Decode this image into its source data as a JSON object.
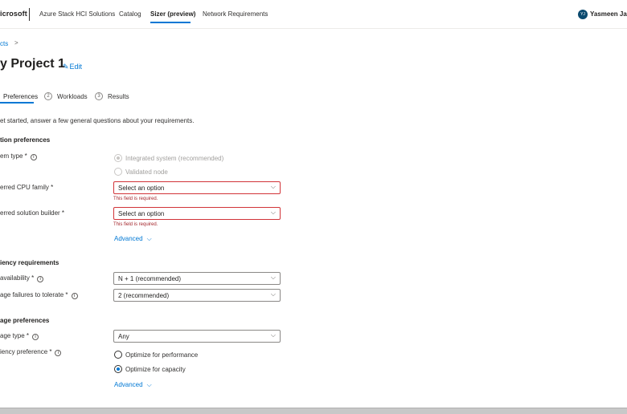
{
  "header": {
    "brand": "icrosoft",
    "nav": [
      "Azure Stack HCI Solutions",
      "Catalog",
      "Sizer (preview)",
      "Network Requirements"
    ],
    "active_nav": "Sizer (preview)",
    "user_initials": "YJ",
    "user_name": "Yasmeen Jassi"
  },
  "breadcrumb": {
    "item": "cts",
    "separator": ">"
  },
  "page": {
    "title": "y Project 1",
    "edit_label": "Edit"
  },
  "steps": [
    {
      "label": "Preferences",
      "number": ""
    },
    {
      "label": "Workloads",
      "number": "2"
    },
    {
      "label": "Results",
      "number": "3"
    }
  ],
  "intro": "et started, answer a few general questions about your requirements.",
  "solution_preferences": {
    "title": "tion preferences",
    "system_type": {
      "label": "em type *",
      "options": [
        {
          "label": "Integrated system (recommended)",
          "checked": true,
          "disabled": true
        },
        {
          "label": "Validated node",
          "checked": false,
          "disabled": true
        }
      ]
    },
    "cpu_family": {
      "label": "erred CPU family *",
      "value": "Select an option",
      "error": "This field is required."
    },
    "solution_builder": {
      "label": "erred solution builder *",
      "value": "Select an option",
      "error": "This field is required."
    },
    "advanced_label": "Advanced"
  },
  "resiliency": {
    "title": "iency requirements",
    "availability": {
      "label": "availability *",
      "value": "N + 1 (recommended)"
    },
    "failures": {
      "label": "age failures to tolerate *",
      "value": "2 (recommended)"
    }
  },
  "storage": {
    "title": "age preferences",
    "storage_type": {
      "label": "age type *",
      "value": "Any"
    },
    "efficiency": {
      "label": "iency preference *",
      "options": [
        {
          "label": "Optimize for performance",
          "checked": false
        },
        {
          "label": "Optimize for capacity",
          "checked": true
        }
      ]
    },
    "advanced_label": "Advanced"
  },
  "icons": {
    "edit": "pencil-icon",
    "info": "info-icon",
    "chevron": "chevron-down-icon"
  },
  "colors": {
    "accent": "#0078d4",
    "error": "#d13438",
    "avatar": "#0b4a6f"
  }
}
